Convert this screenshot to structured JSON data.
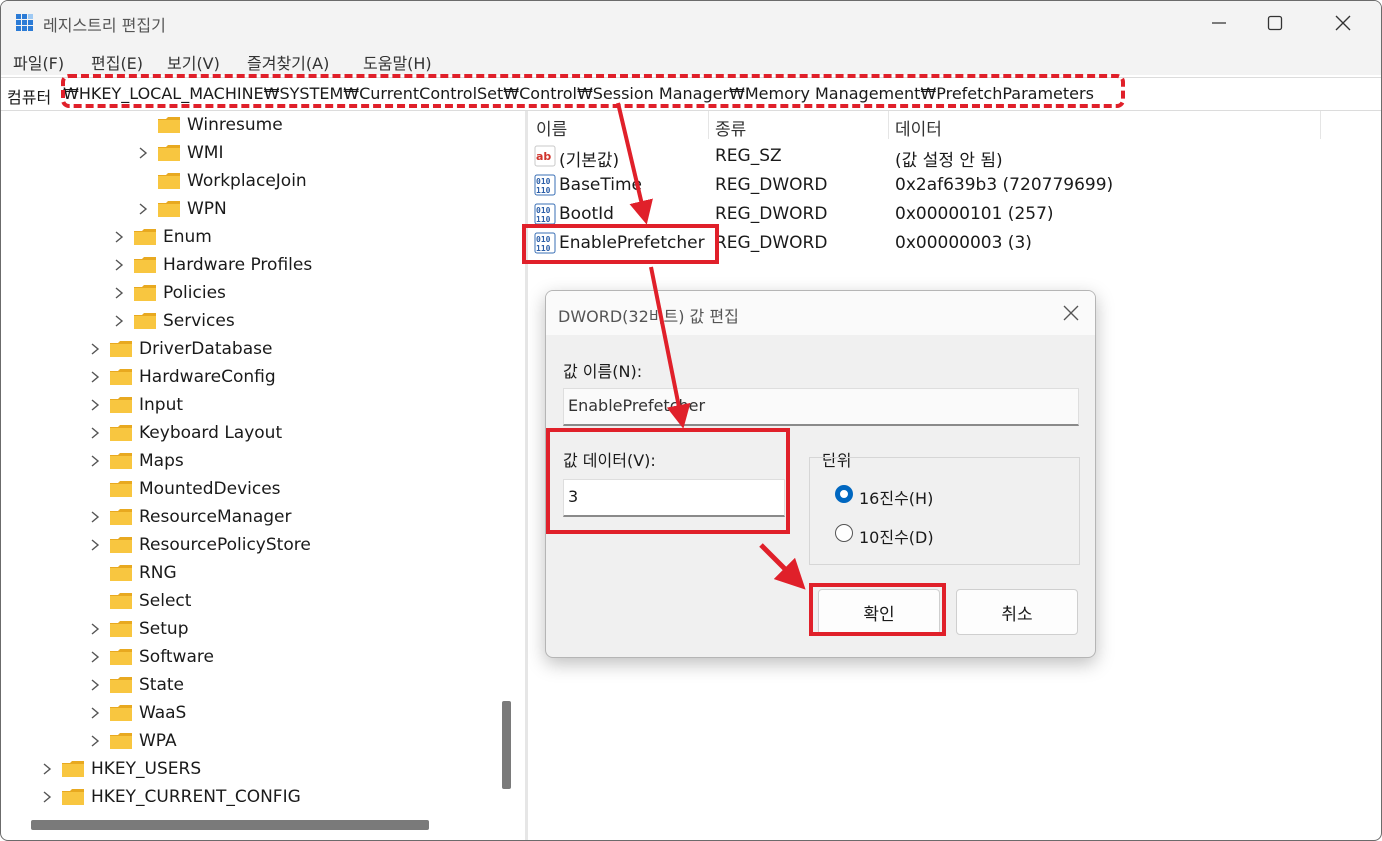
{
  "window": {
    "title": "레지스트리 편집기",
    "minimize_icon": "minimize-icon",
    "maximize_icon": "maximize-icon",
    "close_icon": "close-icon"
  },
  "menu": [
    "파일(F)",
    "편집(E)",
    "보기(V)",
    "즐겨찾기(A)",
    "도움말(H)"
  ],
  "address": {
    "label": "컴퓨터",
    "path": "₩HKEY_LOCAL_MACHINE₩SYSTEM₩CurrentControlSet₩Control₩Session Manager₩Memory Management₩PrefetchParameters"
  },
  "tree": [
    {
      "label": "Winresume",
      "expandable": false
    },
    {
      "label": "WMI",
      "expandable": true
    },
    {
      "label": "WorkplaceJoin",
      "expandable": false
    },
    {
      "label": "WPN",
      "expandable": true
    },
    {
      "label": "Enum",
      "expandable": true
    },
    {
      "label": "Hardware Profiles",
      "expandable": true
    },
    {
      "label": "Policies",
      "expandable": true
    },
    {
      "label": "Services",
      "expandable": true
    },
    {
      "label": "DriverDatabase",
      "expandable": true
    },
    {
      "label": "HardwareConfig",
      "expandable": true
    },
    {
      "label": "Input",
      "expandable": true
    },
    {
      "label": "Keyboard Layout",
      "expandable": true
    },
    {
      "label": "Maps",
      "expandable": true
    },
    {
      "label": "MountedDevices",
      "expandable": false
    },
    {
      "label": "ResourceManager",
      "expandable": true
    },
    {
      "label": "ResourcePolicyStore",
      "expandable": true
    },
    {
      "label": "RNG",
      "expandable": false
    },
    {
      "label": "Select",
      "expandable": false
    },
    {
      "label": "Setup",
      "expandable": true
    },
    {
      "label": "Software",
      "expandable": true
    },
    {
      "label": "State",
      "expandable": true
    },
    {
      "label": "WaaS",
      "expandable": true
    },
    {
      "label": "WPA",
      "expandable": true
    },
    {
      "label": "HKEY_USERS",
      "expandable": true
    },
    {
      "label": "HKEY_CURRENT_CONFIG",
      "expandable": true
    }
  ],
  "list": {
    "columns": [
      "이름",
      "종류",
      "데이터"
    ],
    "rows": [
      {
        "name": "(기본값)",
        "type": "REG_SZ",
        "data": "(값 설정 안 됨)",
        "icon": "string-value-icon"
      },
      {
        "name": "BaseTime",
        "type": "REG_DWORD",
        "data": "0x2af639b3 (720779699)",
        "icon": "binary-value-icon"
      },
      {
        "name": "BootId",
        "type": "REG_DWORD",
        "data": "0x00000101 (257)",
        "icon": "binary-value-icon"
      },
      {
        "name": "EnablePrefetcher",
        "type": "REG_DWORD",
        "data": "0x00000003 (3)",
        "icon": "binary-value-icon"
      }
    ]
  },
  "dialog": {
    "title": "DWORD(32비트) 값 편집",
    "name_label": "값 이름(N):",
    "name_value": "EnablePrefetcher",
    "data_label": "값 데이터(V):",
    "data_value": "3",
    "base_group": "단위",
    "hex_label": "16진수(H)",
    "dec_label": "10진수(D)",
    "selected_base": "hex",
    "ok_label": "확인",
    "cancel_label": "취소"
  },
  "colors": {
    "highlight": "#e0202a",
    "folder": "#f8c640",
    "radio_selected": "#0067c0"
  }
}
